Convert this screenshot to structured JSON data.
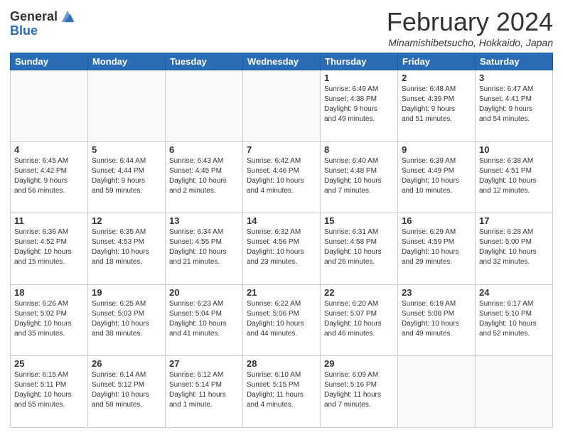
{
  "header": {
    "logo_general": "General",
    "logo_blue": "Blue",
    "month_title": "February 2024",
    "location": "Minamishibetsucho, Hokkaido, Japan"
  },
  "days_of_week": [
    "Sunday",
    "Monday",
    "Tuesday",
    "Wednesday",
    "Thursday",
    "Friday",
    "Saturday"
  ],
  "weeks": [
    [
      {
        "day": "",
        "info": ""
      },
      {
        "day": "",
        "info": ""
      },
      {
        "day": "",
        "info": ""
      },
      {
        "day": "",
        "info": ""
      },
      {
        "day": "1",
        "info": "Sunrise: 6:49 AM\nSunset: 4:38 PM\nDaylight: 9 hours\nand 49 minutes."
      },
      {
        "day": "2",
        "info": "Sunrise: 6:48 AM\nSunset: 4:39 PM\nDaylight: 9 hours\nand 51 minutes."
      },
      {
        "day": "3",
        "info": "Sunrise: 6:47 AM\nSunset: 4:41 PM\nDaylight: 9 hours\nand 54 minutes."
      }
    ],
    [
      {
        "day": "4",
        "info": "Sunrise: 6:45 AM\nSunset: 4:42 PM\nDaylight: 9 hours\nand 56 minutes."
      },
      {
        "day": "5",
        "info": "Sunrise: 6:44 AM\nSunset: 4:44 PM\nDaylight: 9 hours\nand 59 minutes."
      },
      {
        "day": "6",
        "info": "Sunrise: 6:43 AM\nSunset: 4:45 PM\nDaylight: 10 hours\nand 2 minutes."
      },
      {
        "day": "7",
        "info": "Sunrise: 6:42 AM\nSunset: 4:46 PM\nDaylight: 10 hours\nand 4 minutes."
      },
      {
        "day": "8",
        "info": "Sunrise: 6:40 AM\nSunset: 4:48 PM\nDaylight: 10 hours\nand 7 minutes."
      },
      {
        "day": "9",
        "info": "Sunrise: 6:39 AM\nSunset: 4:49 PM\nDaylight: 10 hours\nand 10 minutes."
      },
      {
        "day": "10",
        "info": "Sunrise: 6:38 AM\nSunset: 4:51 PM\nDaylight: 10 hours\nand 12 minutes."
      }
    ],
    [
      {
        "day": "11",
        "info": "Sunrise: 6:36 AM\nSunset: 4:52 PM\nDaylight: 10 hours\nand 15 minutes."
      },
      {
        "day": "12",
        "info": "Sunrise: 6:35 AM\nSunset: 4:53 PM\nDaylight: 10 hours\nand 18 minutes."
      },
      {
        "day": "13",
        "info": "Sunrise: 6:34 AM\nSunset: 4:55 PM\nDaylight: 10 hours\nand 21 minutes."
      },
      {
        "day": "14",
        "info": "Sunrise: 6:32 AM\nSunset: 4:56 PM\nDaylight: 10 hours\nand 23 minutes."
      },
      {
        "day": "15",
        "info": "Sunrise: 6:31 AM\nSunset: 4:58 PM\nDaylight: 10 hours\nand 26 minutes."
      },
      {
        "day": "16",
        "info": "Sunrise: 6:29 AM\nSunset: 4:59 PM\nDaylight: 10 hours\nand 29 minutes."
      },
      {
        "day": "17",
        "info": "Sunrise: 6:28 AM\nSunset: 5:00 PM\nDaylight: 10 hours\nand 32 minutes."
      }
    ],
    [
      {
        "day": "18",
        "info": "Sunrise: 6:26 AM\nSunset: 5:02 PM\nDaylight: 10 hours\nand 35 minutes."
      },
      {
        "day": "19",
        "info": "Sunrise: 6:25 AM\nSunset: 5:03 PM\nDaylight: 10 hours\nand 38 minutes."
      },
      {
        "day": "20",
        "info": "Sunrise: 6:23 AM\nSunset: 5:04 PM\nDaylight: 10 hours\nand 41 minutes."
      },
      {
        "day": "21",
        "info": "Sunrise: 6:22 AM\nSunset: 5:06 PM\nDaylight: 10 hours\nand 44 minutes."
      },
      {
        "day": "22",
        "info": "Sunrise: 6:20 AM\nSunset: 5:07 PM\nDaylight: 10 hours\nand 46 minutes."
      },
      {
        "day": "23",
        "info": "Sunrise: 6:19 AM\nSunset: 5:08 PM\nDaylight: 10 hours\nand 49 minutes."
      },
      {
        "day": "24",
        "info": "Sunrise: 6:17 AM\nSunset: 5:10 PM\nDaylight: 10 hours\nand 52 minutes."
      }
    ],
    [
      {
        "day": "25",
        "info": "Sunrise: 6:15 AM\nSunset: 5:11 PM\nDaylight: 10 hours\nand 55 minutes."
      },
      {
        "day": "26",
        "info": "Sunrise: 6:14 AM\nSunset: 5:12 PM\nDaylight: 10 hours\nand 58 minutes."
      },
      {
        "day": "27",
        "info": "Sunrise: 6:12 AM\nSunset: 5:14 PM\nDaylight: 11 hours\nand 1 minute."
      },
      {
        "day": "28",
        "info": "Sunrise: 6:10 AM\nSunset: 5:15 PM\nDaylight: 11 hours\nand 4 minutes."
      },
      {
        "day": "29",
        "info": "Sunrise: 6:09 AM\nSunset: 5:16 PM\nDaylight: 11 hours\nand 7 minutes."
      },
      {
        "day": "",
        "info": ""
      },
      {
        "day": "",
        "info": ""
      }
    ]
  ]
}
